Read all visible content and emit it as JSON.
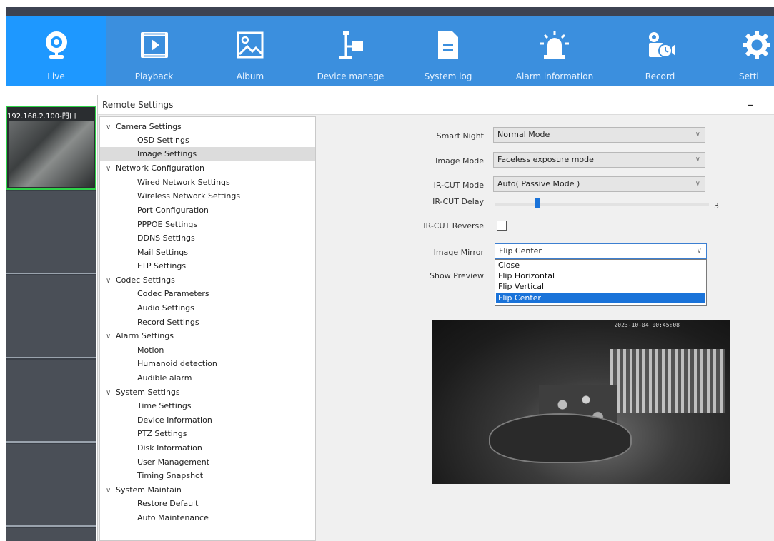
{
  "toolbar": {
    "items": [
      {
        "label": "Live",
        "icon": "webcam-icon",
        "active": true
      },
      {
        "label": "Playback",
        "icon": "film-play-icon",
        "active": false
      },
      {
        "label": "Album",
        "icon": "image-icon",
        "active": false
      },
      {
        "label": "Device manage",
        "icon": "device-network-icon",
        "active": false
      },
      {
        "label": "System log",
        "icon": "document-icon",
        "active": false
      },
      {
        "label": "Alarm information",
        "icon": "siren-icon",
        "active": false
      },
      {
        "label": "Record",
        "icon": "record-camera-icon",
        "active": false
      },
      {
        "label": "Setti",
        "icon": "gear-icon",
        "active": false
      }
    ],
    "colors": {
      "background": "#3b8fde",
      "active": "#1e98ff"
    }
  },
  "cameras": {
    "first_label": "192.168.2.100-門口"
  },
  "window": {
    "title": "Remote Settings",
    "minimize": "–"
  },
  "tree": {
    "categories": [
      {
        "label": "Camera Settings",
        "children": [
          "OSD Settings",
          "Image Settings"
        ]
      },
      {
        "label": "Network Configuration",
        "children": [
          "Wired Network Settings",
          "Wireless Network Settings",
          "Port Configuration",
          "PPPOE Settings",
          "DDNS Settings",
          "Mail Settings",
          "FTP Settings"
        ]
      },
      {
        "label": "Codec Settings",
        "children": [
          "Codec Parameters",
          "Audio Settings",
          "Record Settings"
        ]
      },
      {
        "label": "Alarm Settings",
        "children": [
          "Motion",
          "Humanoid detection",
          "Audible alarm"
        ]
      },
      {
        "label": "System Settings",
        "children": [
          "Time Settings",
          "Device Information",
          "PTZ Settings",
          "Disk Information",
          "User Management",
          "Timing Snapshot"
        ]
      },
      {
        "label": "System Maintain",
        "children": [
          "Restore Default",
          "Auto Maintenance"
        ]
      }
    ],
    "selected": "Image Settings"
  },
  "form": {
    "smart_night": {
      "label": "Smart Night",
      "value": "Normal Mode"
    },
    "image_mode": {
      "label": "Image Mode",
      "value": "Faceless exposure mode"
    },
    "ircut_mode": {
      "label": "IR-CUT Mode",
      "value": "Auto( Passive Mode )"
    },
    "ircut_delay": {
      "label": "IR-CUT Delay",
      "value": "3",
      "level": 0.2
    },
    "ircut_reverse": {
      "label": "IR-CUT Reverse",
      "checked": false
    },
    "image_mirror": {
      "label": "Image Mirror",
      "value": "Flip Center",
      "options": [
        "Close",
        "Flip Horizontal",
        "Flip Vertical",
        "Flip Center"
      ],
      "selected_index": 3
    },
    "show_preview": {
      "label": "Show Preview"
    }
  },
  "preview": {
    "timestamp": "2023-10-04 00:45:08"
  }
}
